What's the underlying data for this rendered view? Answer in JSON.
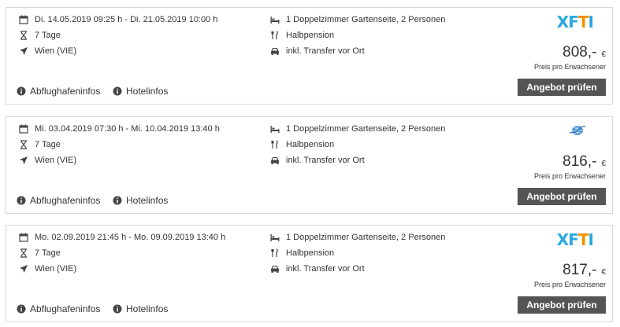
{
  "offers": [
    {
      "dates": "Di. 14.05.2019 09:25 h - Di. 21.05.2019 10:00 h",
      "duration": "7 Tage",
      "airport": "Wien (VIE)",
      "room": "1 Doppelzimmer Gartenseite, 2 Personen",
      "board": "Halbpension",
      "transfer": "inkl. Transfer vor Ort",
      "provider_logo": "XFTI",
      "price": "808,-",
      "currency": "€",
      "price_note": "Preis pro Erwachsener",
      "button": "Angebot prüfen",
      "airport_info": "Abflughafeninfos",
      "hotel_info": "Hotelinfos"
    },
    {
      "dates": "Mi. 03.04.2019 07:30 h - Mi. 10.04.2019 13:40 h",
      "duration": "7 Tage",
      "airport": "Wien (VIE)",
      "room": "1 Doppelzimmer Gartenseite, 2 Personen",
      "board": "Halbpension",
      "transfer": "inkl. Transfer vor Ort",
      "provider_logo": "globe-icon",
      "price": "816,-",
      "currency": "€",
      "price_note": "Preis pro Erwachsener",
      "button": "Angebot prüfen",
      "airport_info": "Abflughafeninfos",
      "hotel_info": "Hotelinfos"
    },
    {
      "dates": "Mo. 02.09.2019 21:45 h - Mo. 09.09.2019 13:40 h",
      "duration": "7 Tage",
      "airport": "Wien (VIE)",
      "room": "1 Doppelzimmer Gartenseite, 2 Personen",
      "board": "Halbpension",
      "transfer": "inkl. Transfer vor Ort",
      "provider_logo": "XFTI",
      "price": "817,-",
      "currency": "€",
      "price_note": "Preis pro Erwachsener",
      "button": "Angebot prüfen",
      "airport_info": "Abflughafeninfos",
      "hotel_info": "Hotelinfos"
    }
  ],
  "colors": {
    "button_bg": "#555555",
    "border": "#d9d9d9",
    "logo_blue": "#2aa8e0",
    "logo_orange": "#f29100"
  }
}
